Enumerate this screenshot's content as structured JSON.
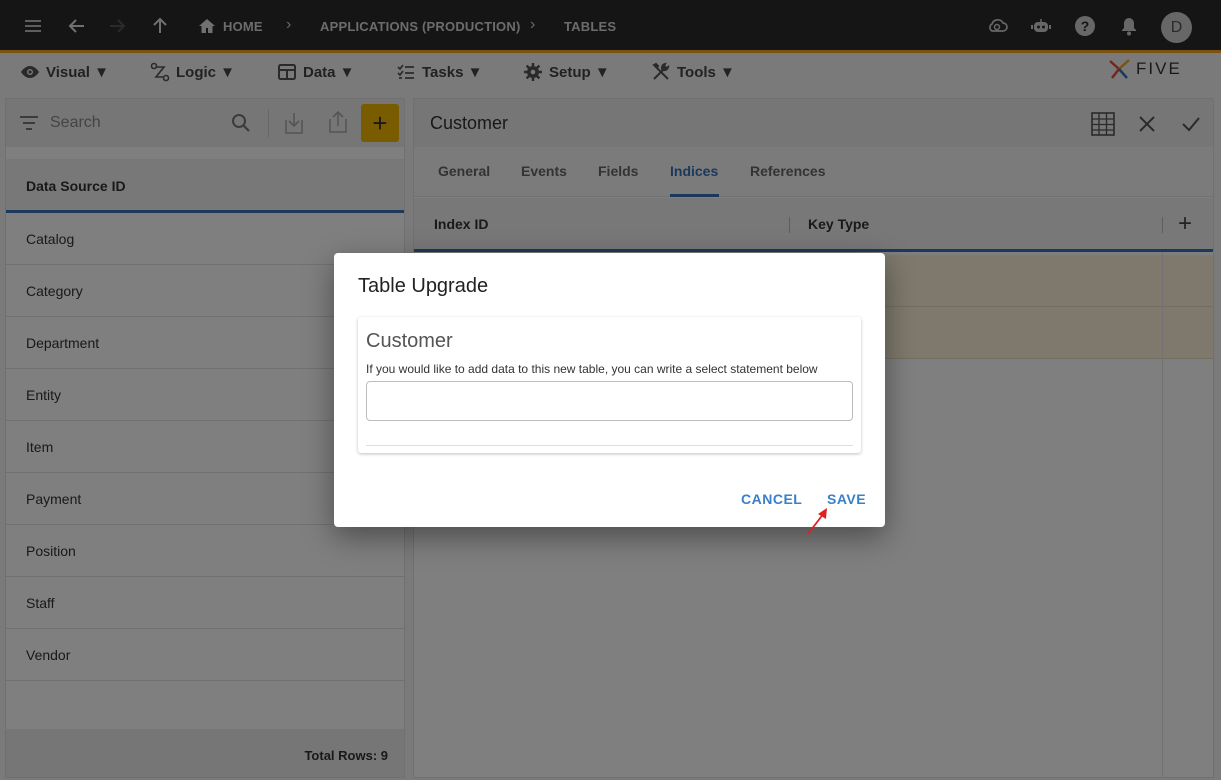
{
  "topbar": {
    "breadcrumbs": [
      "HOME",
      "APPLICATIONS (PRODUCTION)",
      "TABLES"
    ],
    "avatar_initial": "D",
    "icons": [
      "menu-icon",
      "back-arrow-icon",
      "forward-arrow-icon",
      "up-arrow-icon",
      "home-icon",
      "cloud-sync-icon",
      "bot-icon",
      "help-icon",
      "bell-icon"
    ]
  },
  "menubar": {
    "items": [
      {
        "label": "Visual ▼",
        "icon": "eye-icon"
      },
      {
        "label": "Logic ▼",
        "icon": "logic-icon"
      },
      {
        "label": "Data ▼",
        "icon": "table-icon"
      },
      {
        "label": "Tasks ▼",
        "icon": "tasks-icon"
      },
      {
        "label": "Setup ▼",
        "icon": "gear-icon"
      },
      {
        "label": "Tools ▼",
        "icon": "tools-icon"
      }
    ],
    "logo_text": "FIVE"
  },
  "left_panel": {
    "search_placeholder": "Search",
    "add_label": "+",
    "column_header": "Data Source ID",
    "items": [
      "Catalog",
      "Category",
      "Department",
      "Entity",
      "Item",
      "Payment",
      "Position",
      "Staff",
      "Vendor"
    ],
    "footer": "Total Rows: 9"
  },
  "right_panel": {
    "title": "Customer",
    "tabs": [
      "General",
      "Events",
      "Fields",
      "Indices",
      "References"
    ],
    "active_tab": "Indices",
    "columns": [
      "Index ID",
      "Key Type"
    ],
    "add_label": "+"
  },
  "dialog": {
    "title": "Table Upgrade",
    "card_title": "Customer",
    "help_text": "If you would like to add data to this new table, you can write a select statement below",
    "input_value": "",
    "cancel_label": "CANCEL",
    "save_label": "SAVE"
  },
  "colors": {
    "accent": "#3a72b5",
    "brand_yellow": "#f5b800",
    "topbar_bg": "#2b2b2b",
    "topbar_border": "#f5a623",
    "annotation_arrow": "#e02020"
  }
}
